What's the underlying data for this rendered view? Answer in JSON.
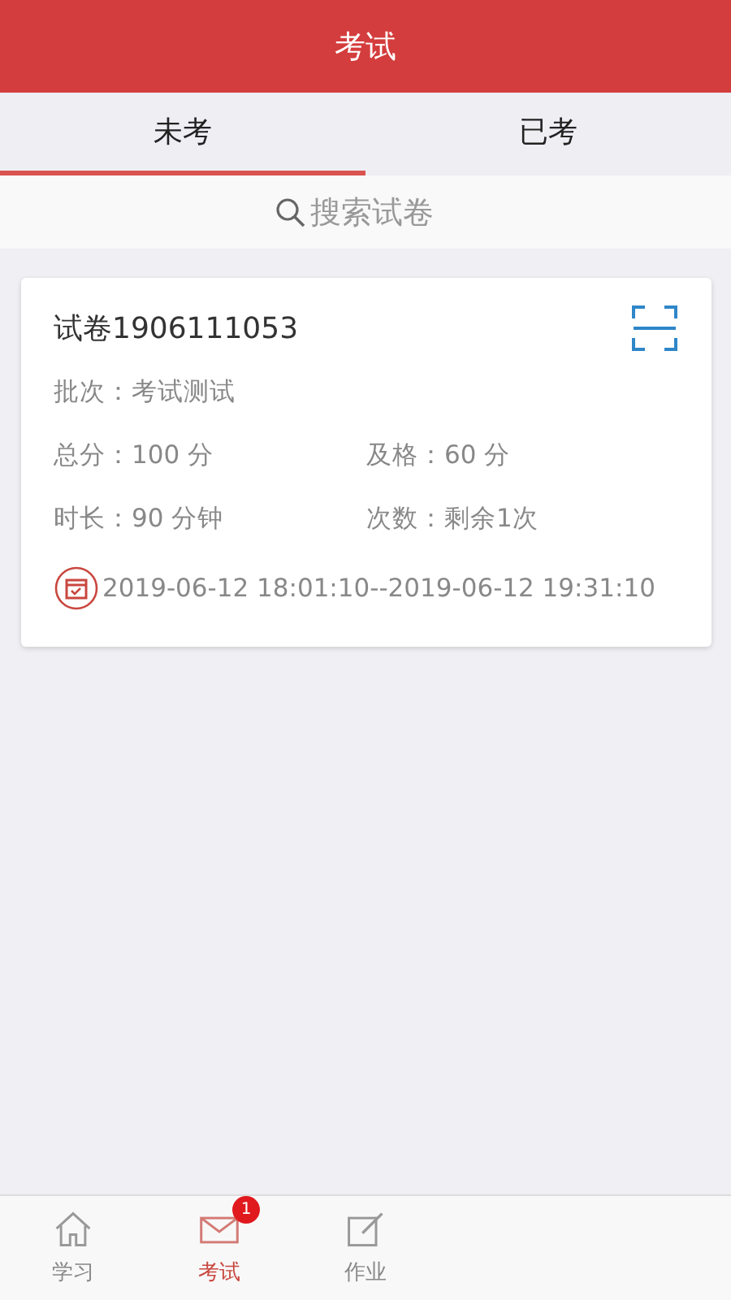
{
  "header": {
    "title": "考试"
  },
  "tabs": [
    {
      "label": "未考",
      "selected": true
    },
    {
      "label": "已考",
      "selected": false
    }
  ],
  "search": {
    "placeholder": "搜索试卷"
  },
  "exams": [
    {
      "title": "试卷1906111053",
      "batch": "批次：考试测试",
      "total_score": "总分：100 分",
      "pass_score": "及格：60 分",
      "duration": "时长：90 分钟",
      "attempts": "次数：剩余1次",
      "time_range": "2019-06-12 18:01:10--2019-06-12 19:31:10"
    }
  ],
  "bottom_nav": [
    {
      "label": "学习",
      "kind": "home",
      "selected": false
    },
    {
      "label": "考试",
      "kind": "mail",
      "selected": true,
      "badge": "1"
    },
    {
      "label": "作业",
      "kind": "edit",
      "selected": false
    }
  ]
}
